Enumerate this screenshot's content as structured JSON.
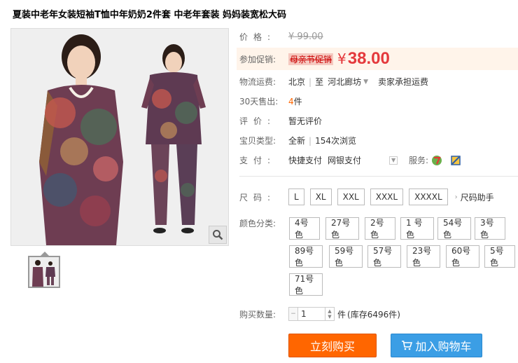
{
  "product": {
    "title": "夏装中老年女装短袖T恤中年奶奶2件套 中老年套装 妈妈装宽松大码"
  },
  "price": {
    "label": "价格:",
    "currency": "¥",
    "original": "99.00"
  },
  "promo": {
    "label": "参加促销:",
    "tag": "母亲节促销",
    "currency": "¥",
    "price": "38.00"
  },
  "shipping": {
    "label": "物流运费:",
    "from": "北京",
    "sep": "|",
    "to_prefix": "至",
    "to": "河北廊坊",
    "fee": "卖家承担运费"
  },
  "sales": {
    "label": "30天售出:",
    "count": "4",
    "unit": "件"
  },
  "review": {
    "label": "评价:",
    "value": "暂无评价"
  },
  "item_type": {
    "label": "宝贝类型:",
    "condition": "全新",
    "sep": "|",
    "views": "154次浏览"
  },
  "payment": {
    "label": "支付:",
    "method1": "快捷支付",
    "method2": "网银支付",
    "service_label": "服务:"
  },
  "size": {
    "label": "尺码:",
    "options": [
      "L",
      "XL",
      "XXL",
      "XXXL",
      "XXXXL"
    ],
    "helper": "尺码助手"
  },
  "color": {
    "label": "颜色分类:",
    "options": [
      "4号色",
      "27号色",
      "2号色",
      "1 号色",
      "54号色",
      "3号色",
      "89号色",
      "59号色",
      "57号色",
      "23号色",
      "60号色",
      "5号色",
      "71号色"
    ]
  },
  "quantity": {
    "label": "购买数量:",
    "value": "1",
    "unit": "件",
    "stock": "(库存6496件)"
  },
  "actions": {
    "buy_now": "立刻购买",
    "add_to_cart": "加入购物车"
  },
  "colors": {
    "price_red": "#e4393c",
    "buy_orange": "#ff6600",
    "cart_blue": "#3b9ee5"
  }
}
